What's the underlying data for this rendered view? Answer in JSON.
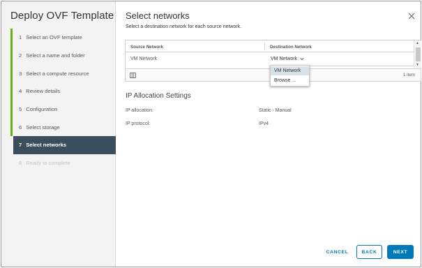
{
  "wizard": {
    "title": "Deploy OVF Template",
    "steps": [
      {
        "num": "1",
        "label": "Select an OVF template",
        "state": "done"
      },
      {
        "num": "2",
        "label": "Select a name and folder",
        "state": "done"
      },
      {
        "num": "3",
        "label": "Select a compute resource",
        "state": "done"
      },
      {
        "num": "4",
        "label": "Review details",
        "state": "done"
      },
      {
        "num": "5",
        "label": "Configuration",
        "state": "done"
      },
      {
        "num": "6",
        "label": "Select storage",
        "state": "done"
      },
      {
        "num": "7",
        "label": "Select networks",
        "state": "active"
      },
      {
        "num": "8",
        "label": "Ready to complete",
        "state": "disabled"
      }
    ]
  },
  "page": {
    "title": "Select networks",
    "subtitle": "Select a destination network for each source network.",
    "close_icon": "close-icon"
  },
  "grid": {
    "columns": [
      "Source Network",
      "Destination Network"
    ],
    "rows": [
      {
        "source": "VM Network",
        "destination": "VM Network"
      }
    ],
    "footer_icon": "column-toggle-icon",
    "item_count": "1 item"
  },
  "dropdown": {
    "options": [
      "VM Network",
      "Browse ..."
    ],
    "selected": "VM Network"
  },
  "ip_settings": {
    "title": "IP Allocation Settings",
    "rows": [
      {
        "label": "IP allocation:",
        "value": "Static - Manual"
      },
      {
        "label": "IP protocol:",
        "value": "IPv4"
      }
    ]
  },
  "buttons": {
    "cancel": "CANCEL",
    "back": "BACK",
    "next": "NEXT"
  },
  "colors": {
    "accent": "#0079b8",
    "step_done": "#60b515",
    "step_active_bg": "#3c4e5e"
  }
}
